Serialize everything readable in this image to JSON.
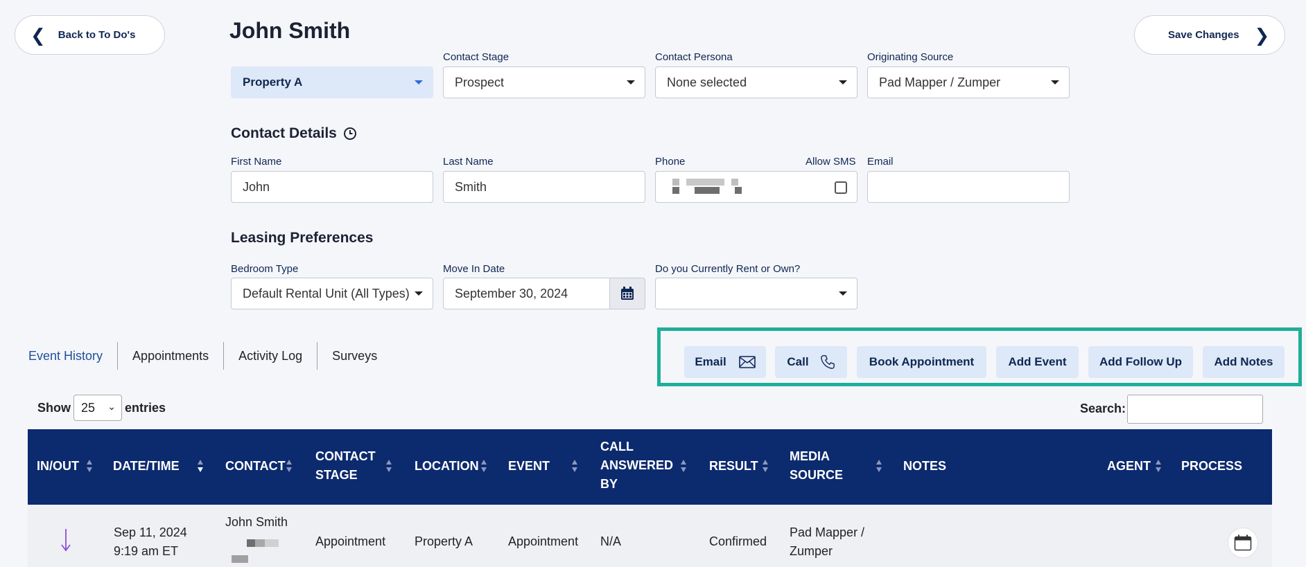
{
  "nav": {
    "back_label": "Back to To Do's",
    "save_label": "Save Changes"
  },
  "contact": {
    "name": "John Smith"
  },
  "top_selects": {
    "property": "Property A",
    "stage_label": "Contact Stage",
    "stage": "Prospect",
    "persona_label": "Contact Persona",
    "persona": "None selected",
    "source_label": "Originating Source",
    "source": "Pad Mapper / Zumper"
  },
  "details": {
    "heading": "Contact Details",
    "first_label": "First Name",
    "first": "John",
    "last_label": "Last Name",
    "last": "Smith",
    "phone_label": "Phone",
    "sms_label": "Allow SMS",
    "email_label": "Email",
    "email": ""
  },
  "leasing": {
    "heading": "Leasing Preferences",
    "bedroom_label": "Bedroom Type",
    "bedroom": "Default Rental Unit (All Types)",
    "move_label": "Move In Date",
    "move": "September 30, 2024",
    "rent_label": "Do you Currently Rent or Own?",
    "rent": ""
  },
  "tabs": [
    "Event History",
    "Appointments",
    "Activity Log",
    "Surveys"
  ],
  "actions": [
    "Email",
    "Call",
    "Book Appointment",
    "Add Event",
    "Add Follow Up",
    "Add Notes"
  ],
  "table": {
    "show_label": "Show",
    "entries_value": "25",
    "entries_label": "entries",
    "search_label": "Search:",
    "headers": [
      "IN/OUT",
      "DATE/TIME",
      "CONTACT",
      "CONTACT STAGE",
      "LOCATION",
      "EVENT",
      "CALL ANSWERED BY",
      "RESULT",
      "MEDIA SOURCE",
      "NOTES",
      "AGENT",
      "PROCESS"
    ],
    "row": {
      "date": "Sep 11, 2024",
      "time": "9:19 am ET",
      "contact": "John Smith",
      "stage": "Appointment",
      "location": "Property A",
      "event": "Appointment",
      "answered": "N/A",
      "result": "Confirmed",
      "source_line1": "Pad Mapper /",
      "source_line2": "Zumper",
      "notes": "",
      "agent": ""
    }
  },
  "colors": {
    "navy": "#0c2a6e",
    "accent_bg": "#dde8f8",
    "highlight": "#1fae99"
  }
}
